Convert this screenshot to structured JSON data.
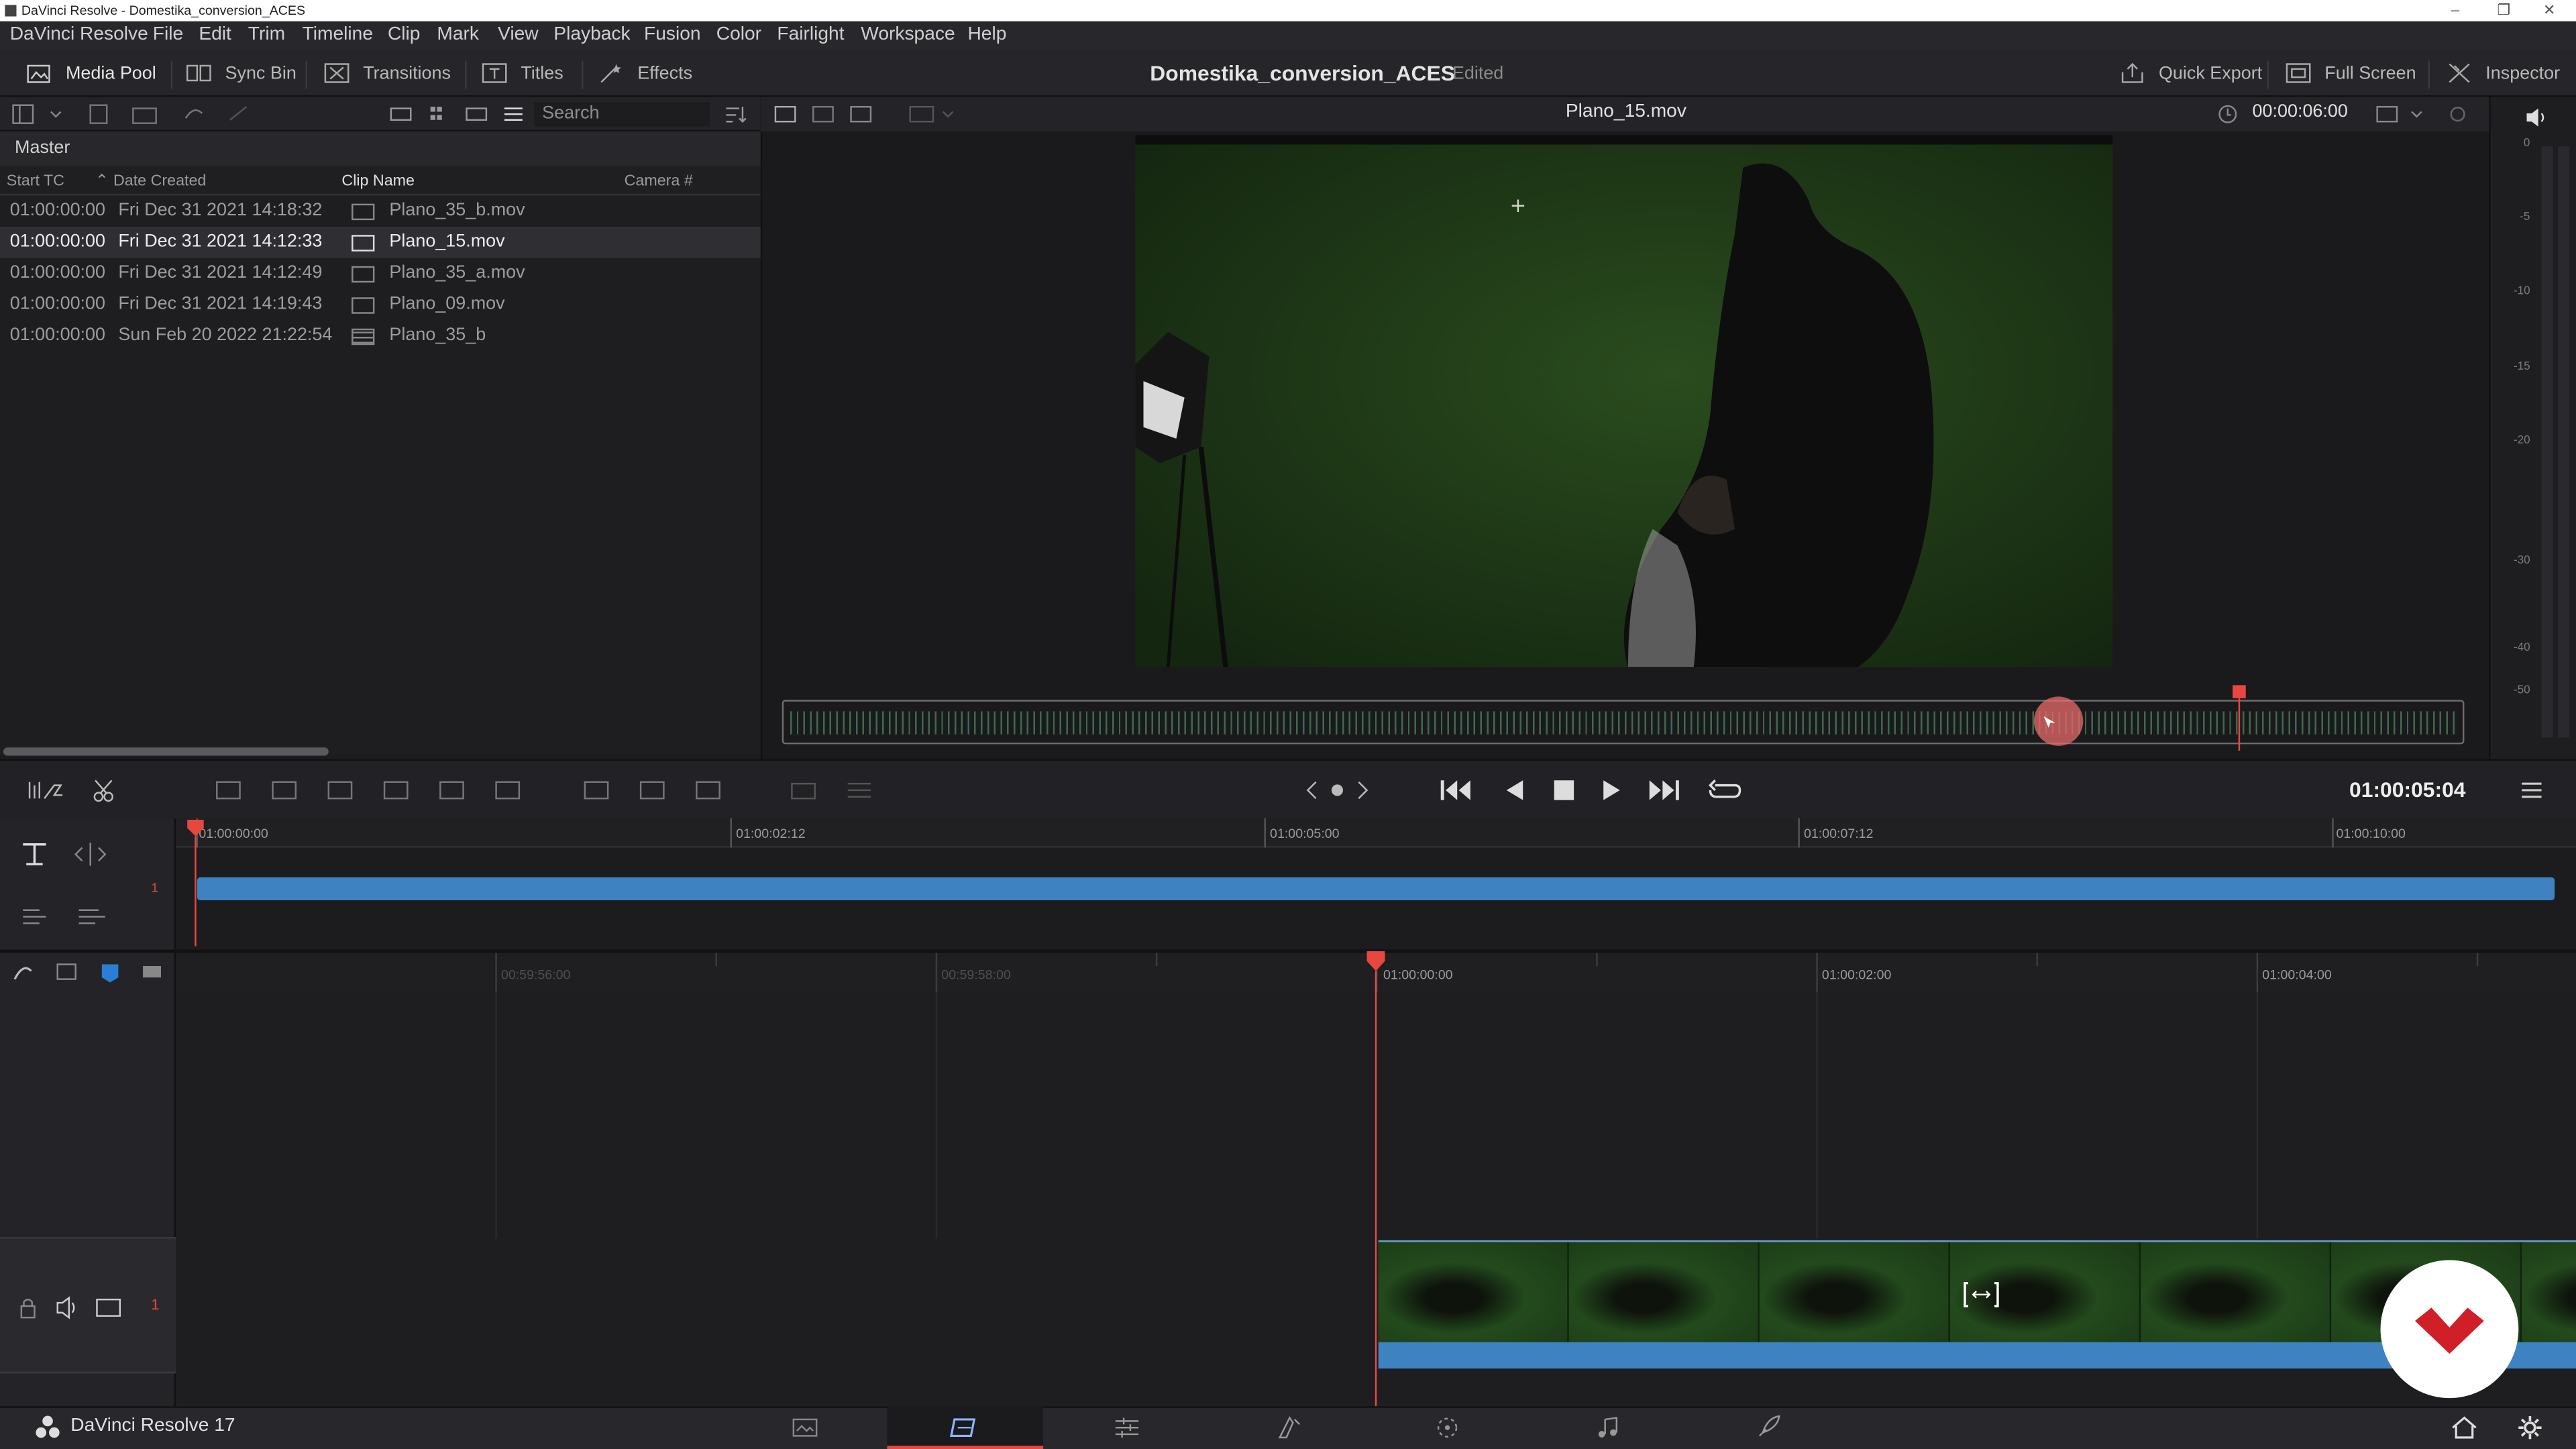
{
  "window": {
    "title": "DaVinci Resolve - Domestika_conversion_ACES"
  },
  "menu": [
    "DaVinci Resolve",
    "File",
    "Edit",
    "Trim",
    "Timeline",
    "Clip",
    "Mark",
    "View",
    "Playback",
    "Fusion",
    "Color",
    "Fairlight",
    "Workspace",
    "Help"
  ],
  "toolbar": {
    "media_pool": "Media Pool",
    "sync_bin": "Sync Bin",
    "transitions": "Transitions",
    "titles": "Titles",
    "effects": "Effects",
    "project_name": "Domestika_conversion_ACES",
    "project_status": "Edited",
    "quick_export": "Quick Export",
    "full_screen": "Full Screen",
    "inspector": "Inspector"
  },
  "media_pool": {
    "search_placeholder": "Search",
    "bin": "Master",
    "columns": [
      "Start TC",
      "Date Created",
      "Clip Name",
      "Camera #"
    ],
    "rows": [
      {
        "start_tc": "01:00:00:00",
        "date": "Fri Dec 31 2021 14:18:32",
        "clip": "Plano_35_b.mov",
        "selected": false
      },
      {
        "start_tc": "01:00:00:00",
        "date": "Fri Dec 31 2021 14:12:33",
        "clip": "Plano_15.mov",
        "selected": true
      },
      {
        "start_tc": "01:00:00:00",
        "date": "Fri Dec 31 2021 14:12:49",
        "clip": "Plano_35_a.mov",
        "selected": false
      },
      {
        "start_tc": "01:00:00:00",
        "date": "Fri Dec 31 2021 14:19:43",
        "clip": "Plano_09.mov",
        "selected": false
      },
      {
        "start_tc": "01:00:00:00",
        "date": "Sun Feb 20 2022 21:22:54",
        "clip": "Plano_35_b",
        "selected": false
      }
    ]
  },
  "viewer": {
    "clip_name": "Plano_15.mov",
    "duration": "00:00:06:00",
    "timecode": "01:00:05:04",
    "meter_labels": [
      "0",
      "-5",
      "-10",
      "-15",
      "-20",
      "-30",
      "-40",
      "-50"
    ]
  },
  "timeline": {
    "upper_ruler": [
      "01:00:00:00",
      "01:00:02:12",
      "01:00:05:00",
      "01:00:07:12",
      "01:00:10:00"
    ],
    "lower_ruler": [
      "00:59:56:00",
      "00:59:58:00",
      "01:00:00:00",
      "01:00:02:00",
      "01:00:04:00"
    ],
    "track_number": "1",
    "video_track_number": "1"
  },
  "footer": {
    "app_label": "DaVinci Resolve 17"
  },
  "colors": {
    "accent_blue": "#3f82c2",
    "playhead_red": "#e8473f"
  }
}
